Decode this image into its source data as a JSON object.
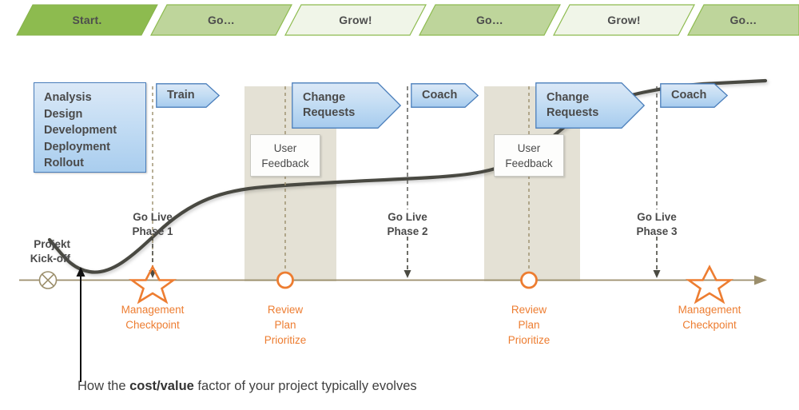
{
  "banner": {
    "steps": [
      {
        "label": "Start.",
        "tone": "dark"
      },
      {
        "label": "Go…",
        "tone": "mid"
      },
      {
        "label": "Grow!",
        "tone": "light"
      },
      {
        "label": "Go…",
        "tone": "mid"
      },
      {
        "label": "Grow!",
        "tone": "light"
      },
      {
        "label": "Go…",
        "tone": "mid"
      }
    ]
  },
  "workstream": {
    "task_box": {
      "lines": [
        "Analysis",
        "Design",
        "Development",
        "Deployment",
        "Rollout"
      ]
    },
    "arrows": [
      {
        "label": "Train"
      },
      {
        "label": "Change\nRequests"
      },
      {
        "label": "Coach"
      },
      {
        "label": "Change\nRequests"
      },
      {
        "label": "Coach"
      }
    ],
    "callouts": [
      {
        "line1": "User",
        "line2": "Feedback"
      },
      {
        "line1": "User",
        "line2": "Feedback"
      }
    ]
  },
  "timeline": {
    "start_marker_label_line1": "Projekt",
    "start_marker_label_line2": "Kick-off",
    "golive_markers": [
      {
        "line1": "Go Live",
        "line2": "Phase 1"
      },
      {
        "line1": "Go Live",
        "line2": "Phase 2"
      },
      {
        "line1": "Go Live",
        "line2": "Phase 3"
      }
    ],
    "checkpoints": [
      {
        "lines": [
          "Management",
          "Checkpoint"
        ],
        "shape": "star"
      },
      {
        "lines": [
          "Review",
          "Plan",
          "Prioritize"
        ],
        "shape": "circle"
      },
      {
        "lines": [
          "Review",
          "Plan",
          "Prioritize"
        ],
        "shape": "circle"
      },
      {
        "lines": [
          "Management",
          "Checkpoint"
        ],
        "shape": "star"
      }
    ]
  },
  "caption": {
    "pre": "How the ",
    "strong": "cost/value",
    "post": " factor of your project typically evolves"
  },
  "colors": {
    "green_dark": "#8DBB4F",
    "green_mid": "#BED59B",
    "green_light": "#F0F5E8",
    "green_border": "#8DBB4F",
    "band": "#E4E1D5",
    "axis": "#9B8E6B",
    "orange": "#ED7D31",
    "curve": "#4A4A42",
    "blue_border": "#4A7EBB",
    "text_grey": "#4A4A4A"
  }
}
